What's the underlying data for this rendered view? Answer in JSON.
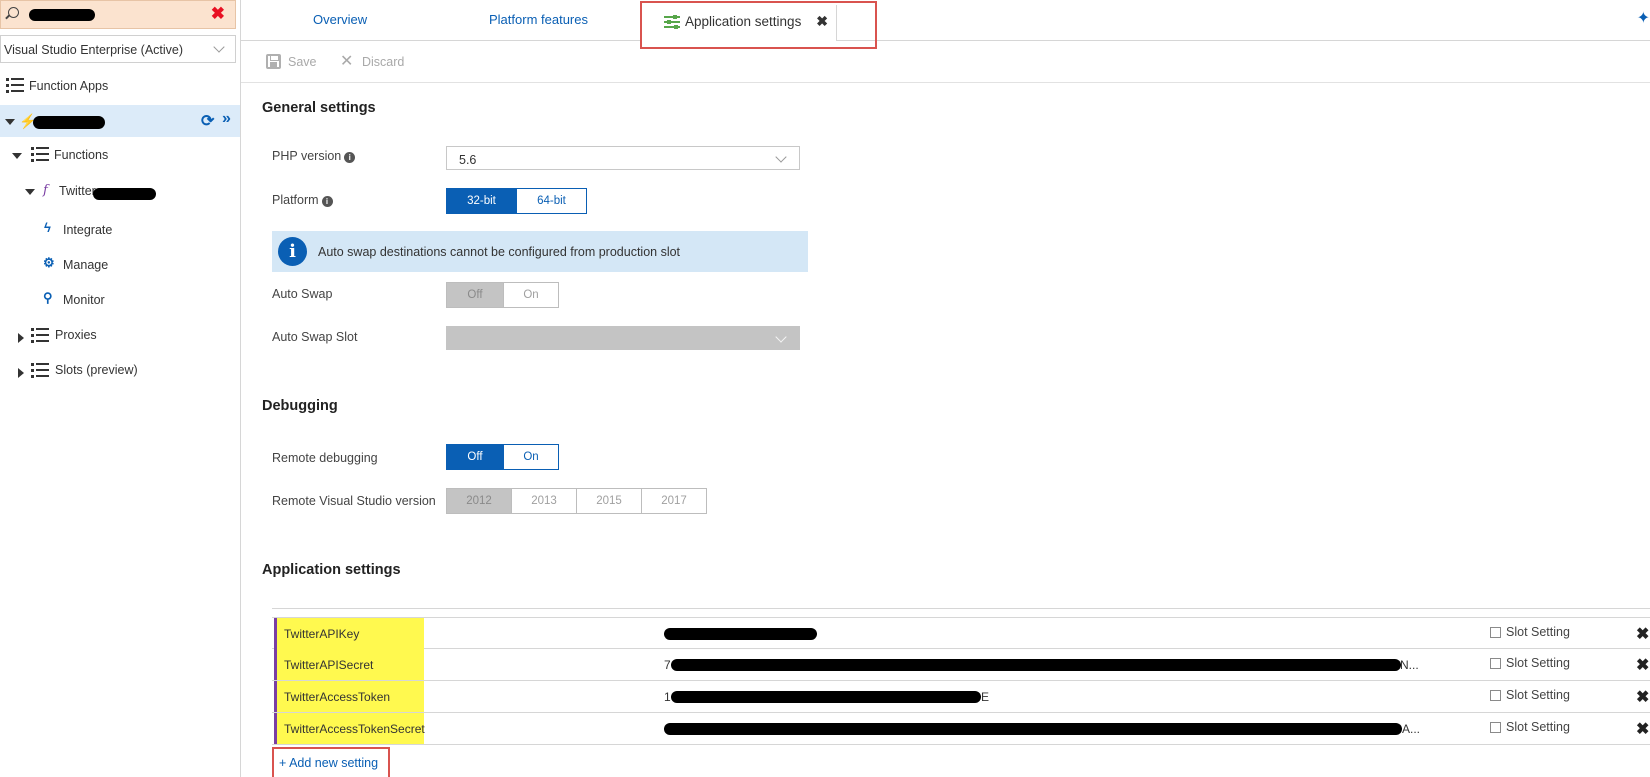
{
  "sidebar": {
    "subscription": "Visual Studio Enterprise (Active)",
    "function_apps_label": "Function Apps",
    "functions_label": "Functions",
    "function_name_prefix": "Twitter",
    "integrate_label": "Integrate",
    "manage_label": "Manage",
    "monitor_label": "Monitor",
    "proxies_label": "Proxies",
    "slots_label": "Slots (preview)"
  },
  "tabs": {
    "overview": "Overview",
    "platform_features": "Platform features",
    "application_settings": "Application settings"
  },
  "toolbar": {
    "save_label": "Save",
    "discard_label": "Discard"
  },
  "general": {
    "title": "General settings",
    "php_label": "PHP version",
    "php_value": "5.6",
    "platform_label": "Platform",
    "platform_options": [
      "32-bit",
      "64-bit"
    ],
    "platform_selected": "32-bit",
    "info_text": "Auto swap destinations cannot be configured from production slot",
    "auto_swap_label": "Auto Swap",
    "auto_swap_options": [
      "Off",
      "On"
    ],
    "auto_swap_selected": "Off",
    "auto_swap_slot_label": "Auto Swap Slot"
  },
  "debugging": {
    "title": "Debugging",
    "remote_label": "Remote debugging",
    "remote_options": [
      "Off",
      "On"
    ],
    "remote_selected": "Off",
    "vs_label": "Remote Visual Studio version",
    "vs_options": [
      "2012",
      "2013",
      "2015",
      "2017"
    ],
    "vs_selected": "2012"
  },
  "app_settings": {
    "title": "Application settings",
    "rows": [
      {
        "key": "TwitterAPIKey",
        "value_prefix": "",
        "value_suffix": "",
        "slot_label": "Slot Setting"
      },
      {
        "key": "TwitterAPISecret",
        "value_prefix": "7",
        "value_suffix": "N...",
        "slot_label": "Slot Setting"
      },
      {
        "key": "TwitterAccessToken",
        "value_prefix": "1",
        "value_suffix": "E",
        "slot_label": "Slot Setting"
      },
      {
        "key": "TwitterAccessTokenSecret",
        "value_prefix": "",
        "value_suffix": "A...",
        "slot_label": "Slot Setting"
      }
    ],
    "add_label": "+ Add new setting"
  },
  "colors": {
    "accent": "#0a5fb4",
    "highlight_red": "#d9534f",
    "key_yellow": "#fff94f",
    "sidebar_selected": "#dcebf9",
    "search_bg": "#fbe3cf"
  },
  "icons": [
    "search-icon",
    "close-icon",
    "list-icon",
    "function-app-icon",
    "refresh-icon",
    "double-chevron-icon",
    "function-icon",
    "bolt-icon",
    "gear-icon",
    "magnifier-icon",
    "settings-sliders-icon",
    "pin-icon",
    "save-icon",
    "discard-icon",
    "info-icon"
  ]
}
